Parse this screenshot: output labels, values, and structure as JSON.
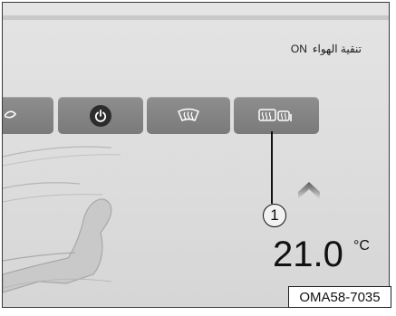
{
  "status": {
    "label": "تنقية الهواء",
    "state": "ON"
  },
  "buttons": [
    {
      "icon": "partial-left-icon"
    },
    {
      "icon": "power-icon"
    },
    {
      "icon": "front-defrost-icon"
    },
    {
      "icon": "rear-mirror-defrost-icon"
    }
  ],
  "callout": {
    "number": "1"
  },
  "temperature": {
    "value": "21.0",
    "unit": "°C"
  },
  "figure_code": "OMA58-7035",
  "colors": {
    "panel": "#dcdcdc",
    "button": "#808080",
    "icon": "#ffffff"
  }
}
